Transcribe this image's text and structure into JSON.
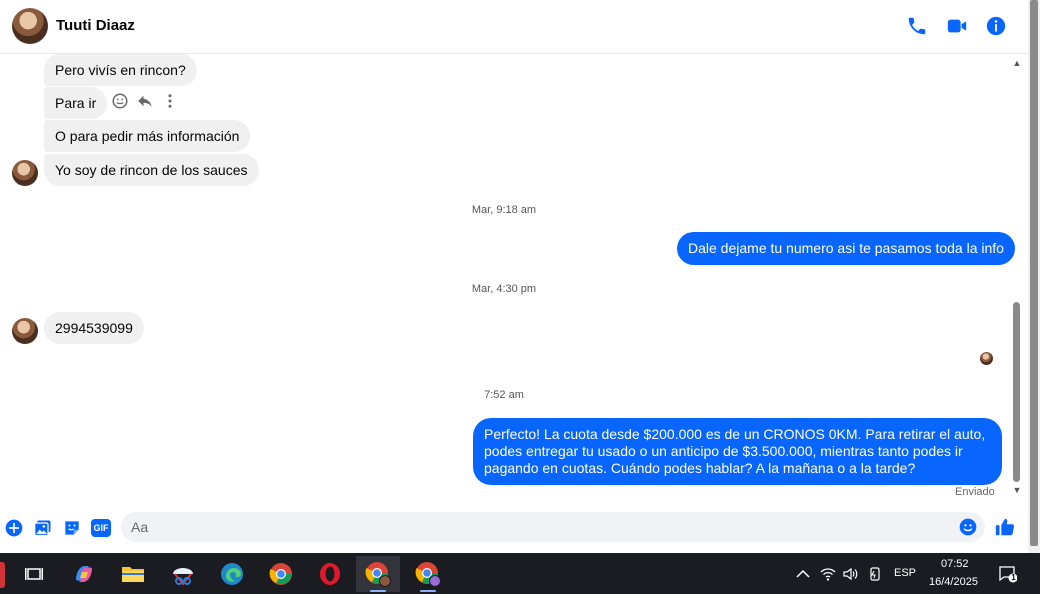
{
  "header": {
    "contact_name": "Tuuti Diaaz",
    "icons": [
      "phone-icon",
      "video-camera-icon",
      "info-icon"
    ],
    "accent_color": "#0866ff"
  },
  "messages": {
    "in_1": "Pero vivís en rincon?",
    "in_2": "Para ir",
    "in_3": "O para pedir más información",
    "in_4": "Yo soy de rincon de los sauces",
    "ts_1": "Mar, 9:18 am",
    "out_1": "Dale dejame tu numero asi te pasamos toda la info",
    "ts_2": "Mar, 4:30 pm",
    "in_5": "2994539099",
    "ts_3": "7:52 am",
    "out_2": "Perfecto! La cuota desde $200.000 es de un CRONOS 0KM. Para retirar el auto, podes entregar tu usado o un anticipo de $3.500.000, mientras tanto podes ir pagando en cuotas. Cuándo podes hablar? A la mañana o a la tarde?",
    "status": "Enviado",
    "bubble_in_color": "#f0f0f0",
    "bubble_out_color": "#0866ff"
  },
  "composer": {
    "placeholder": "Aa",
    "icons": [
      "plus-icon",
      "photo-icon",
      "sticker-icon",
      "gif-icon",
      "emoji-icon",
      "like-icon"
    ],
    "gif_label": "GIF"
  },
  "taskbar": {
    "language": "ESP",
    "time": "07:52",
    "date": "16/4/2025",
    "notification_count": "1",
    "apps": [
      "task-view",
      "copilot",
      "file-explorer",
      "snipping-tool",
      "edge",
      "chrome",
      "opera",
      "chrome-profile-1",
      "chrome-profile-2"
    ]
  }
}
